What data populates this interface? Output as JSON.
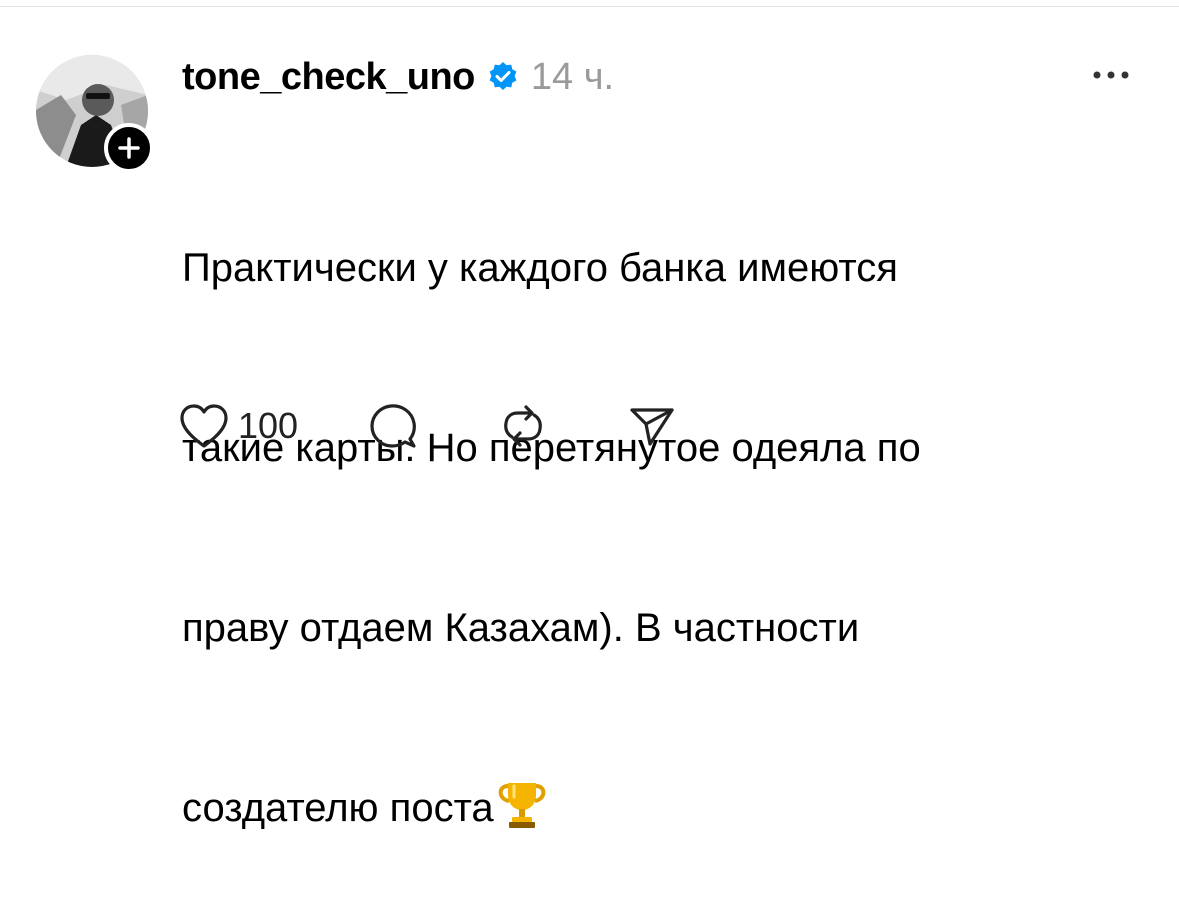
{
  "post": {
    "username": "tone_check_uno",
    "verified": true,
    "timestamp": "14 ч.",
    "text_lines": [
      "Практически у каждого банка имеются",
      "такие карты. Но перетянутое одеяла по",
      "праву отдаем Казахам). В частности",
      "создателю поста"
    ],
    "trailing_emoji": "trophy-icon"
  },
  "actions": {
    "like_count": "100",
    "icons": [
      "heart-icon",
      "comment-icon",
      "repost-icon",
      "share-icon"
    ]
  },
  "colors": {
    "verified_blue": "#0095f6",
    "timestamp_gray": "#9a9a9a",
    "follow_badge": "#000000"
  }
}
